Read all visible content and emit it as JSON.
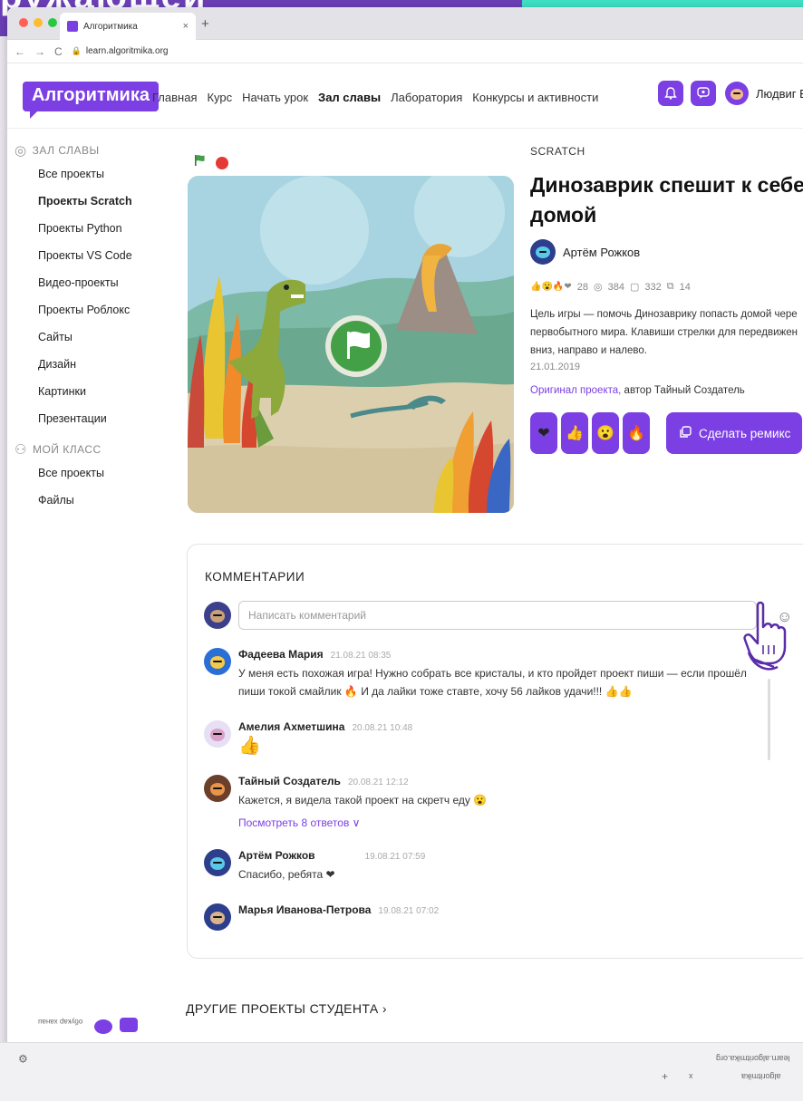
{
  "colors": {
    "accent": "#7b3fe4",
    "background_top": "#6a3fb5",
    "mint": "#3ee0c4",
    "stop": "#e53935",
    "flag": "#2e7d32"
  },
  "backdrop": {
    "word": "ружающей"
  },
  "browser": {
    "tab_title": "Алгоритмика",
    "tab_close": "×",
    "new_tab": "+",
    "url": "learn.algoritmika.org",
    "back_icon": "←",
    "forward_icon": "→",
    "reload_icon": "C"
  },
  "header": {
    "logo": "Алгоритмика",
    "nav": [
      "Главная",
      "Курс",
      "Начать урок",
      "Зал славы",
      "Лаборатория",
      "Конкурсы и активности"
    ],
    "active_nav": "Зал славы",
    "user_name": "Людвиг Бь",
    "icons": [
      "bell-icon",
      "chat-icon",
      "user-avatar"
    ]
  },
  "sidebar": {
    "section1": {
      "title": "ЗАЛ СЛАВЫ",
      "icon": "globe-icon",
      "items": [
        "Все проекты",
        "Проекты Scratch",
        "Проекты Python",
        "Проекты VS Code",
        "Видео-проекты",
        "Проекты Роблокс",
        "Сайты",
        "Дизайн",
        "Картинки",
        "Презентации"
      ]
    },
    "active_item": "Проекты Scratch",
    "section2": {
      "title": "МОЙ КЛАСС",
      "icon": "people-icon",
      "items": [
        "Все проекты",
        "Файлы"
      ]
    }
  },
  "project": {
    "tag": "SCRATCH",
    "title_line1": "Динозаврик спешит к себе",
    "title_line2": "домой",
    "author": "Артём Рожков",
    "stats": {
      "reactions": "28",
      "views": "384",
      "comments": "332",
      "remixes": "14"
    },
    "description_line1": "Цель игры — помочь Динозаврику попасть домой чере",
    "description_line2": "первобытного мира. Клавиши стрелки для передвижен",
    "description_line3": "вниз, направо и налево.",
    "date": "21.01.2019",
    "original_link": "Оригинал проекта,",
    "original_author": "автор Тайный Создатель",
    "reaction_buttons": [
      "❤",
      "👍",
      "😮",
      "🔥"
    ],
    "remix_label": "Сделать ремикс"
  },
  "comments": {
    "title": "КОММЕНТАРИИ",
    "placeholder": "Написать комментарий",
    "items": [
      {
        "name": "Фадеева Мария",
        "time": "21.08.21 08:35",
        "text": "У меня есть похожая игра! Нужно собрать все кристалы, и кто пройдет проект пиши — если прошёл пиши токой смайлик 🔥 И да лайки тоже ставте, хочу 56 лайков удачи!!! 👍👍"
      },
      {
        "name": "Амелия Ахметшина",
        "time": "20.08.21 10:48",
        "text": "👍"
      },
      {
        "name": "Тайный Создатель",
        "time": "20.08.21 12:12",
        "text": "Кажется, я видела такой проект на скретч еду 😮",
        "replies": "Посмотреть 8 ответов ∨"
      },
      {
        "name": "Артём Рожков",
        "time": "19.08.21 07:59",
        "text": "Спасибо, ребята ❤"
      },
      {
        "name": "Марья Иванова-Петрова",
        "time": "19.08.21 07:02",
        "text": ""
      }
    ]
  },
  "other_projects": "ДРУГИЕ ПРОЕКТЫ СТУДЕНТА ›",
  "bottom": {
    "mirror_url": "learn.algoritmika.org",
    "mirror_small": "algoritmika",
    "mirror_left": "обукар ханаu"
  }
}
